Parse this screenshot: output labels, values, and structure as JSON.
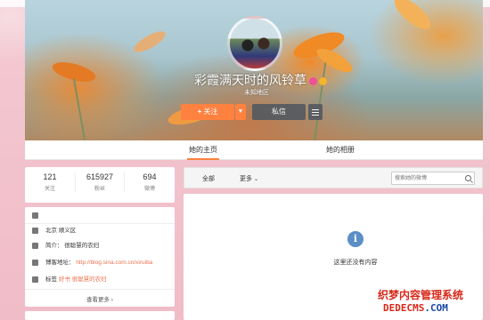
{
  "topbar": {
    "link": "···"
  },
  "profile": {
    "name": "彩霞满天时的风铃草",
    "subtitle": "未知地区",
    "follow_button": "关注",
    "follow_plus": "+",
    "dropdown_arrow": "▼",
    "message_button": "私信"
  },
  "tabs": [
    {
      "label": "她的主页"
    },
    {
      "label": "她的相册"
    }
  ],
  "stats": [
    {
      "value": "121",
      "label": "关注"
    },
    {
      "value": "615927",
      "label": "粉丝"
    },
    {
      "value": "694",
      "label": "微博"
    }
  ],
  "info": {
    "location": "北京 顺义区",
    "intro": "简介：  很聪慧的农妇",
    "blog_label": "博客地址：",
    "blog_url": "http://blog.sina.com.cn/xiruiba",
    "tags_label": "标签",
    "tags": "好书  很聪慧的农妇",
    "more": "查看更多 ›"
  },
  "feed": {
    "filter_all": "全部",
    "filter_more": "更多",
    "more_arrow": "⌄",
    "search_placeholder": "搜索她的微博",
    "empty_icon": "i",
    "empty_text": "这里还没有内容"
  },
  "watermark": {
    "line1": "织梦内容管理系统",
    "line2_a": "DEDECMS",
    "line2_b": ".COM"
  }
}
